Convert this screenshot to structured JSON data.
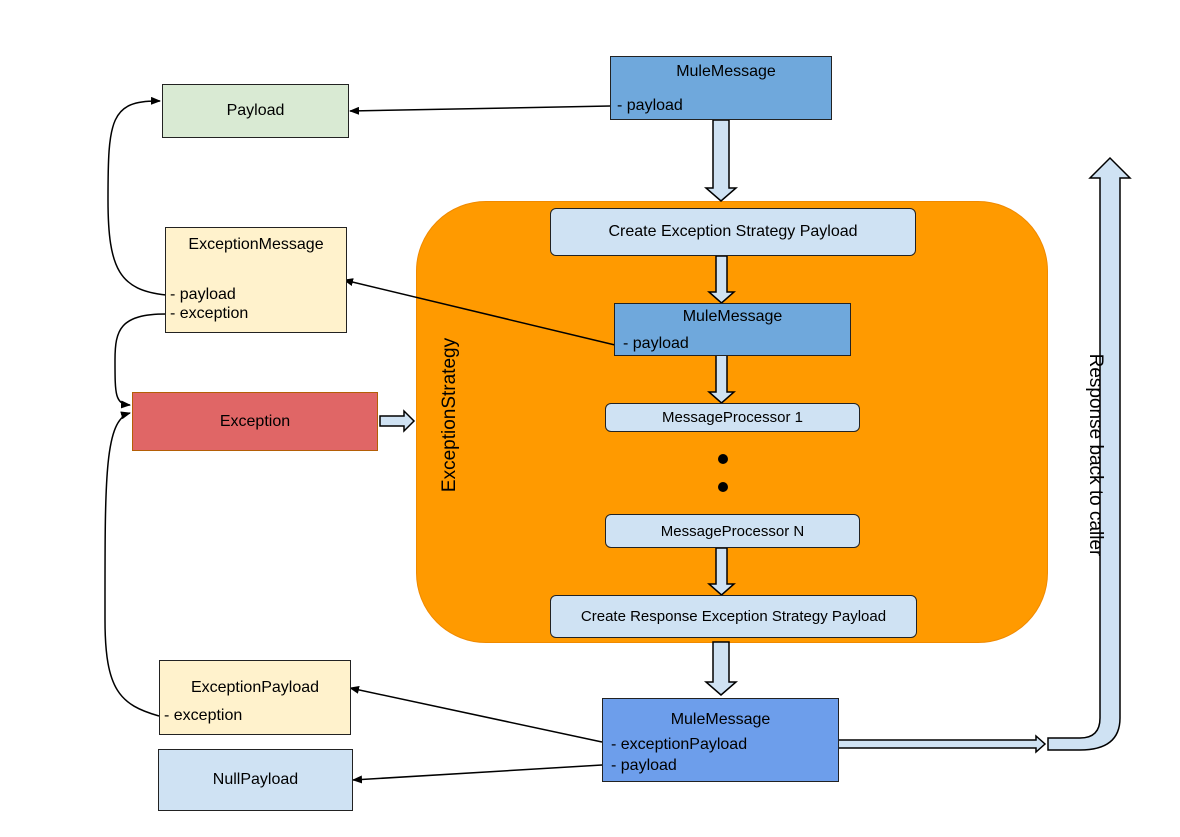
{
  "colors": {
    "mule_message": "#6fa8dc",
    "mule_message_result": "#6d9eeb",
    "payload_box": "#d9ead3",
    "exception_message_box": "#fff2cc",
    "exception_box": "#e06666",
    "exception_border": "#b45f06",
    "null_payload_box": "#cfe2f3",
    "step_box": "#cfe2f3",
    "strategy_container": "#ff9900",
    "block_arrow": "#cfe2f3"
  },
  "nodes": {
    "mule_message_top": {
      "title": "MuleMessage",
      "fields": [
        "- payload"
      ]
    },
    "payload": {
      "title": "Payload"
    },
    "exception_message": {
      "title": "ExceptionMessage",
      "fields": [
        "- payload",
        "- exception"
      ]
    },
    "exception": {
      "title": "Exception"
    },
    "exception_strategy": {
      "label": "ExceptionStrategy"
    },
    "create_payload": {
      "title": "Create Exception Strategy Payload"
    },
    "mule_message_inner": {
      "title": "MuleMessage",
      "fields": [
        "- payload"
      ]
    },
    "processor_1": {
      "title": "MessageProcessor 1"
    },
    "processor_n": {
      "title": "MessageProcessor N"
    },
    "create_response": {
      "title": "Create Response Exception Strategy Payload"
    },
    "exception_payload": {
      "title": "ExceptionPayload",
      "fields": [
        "- exception"
      ]
    },
    "null_payload": {
      "title": "NullPayload"
    },
    "mule_message_result": {
      "title": "MuleMessage",
      "fields": [
        "- exceptionPayload",
        "- payload"
      ]
    },
    "response_label": "Response back to caller"
  }
}
